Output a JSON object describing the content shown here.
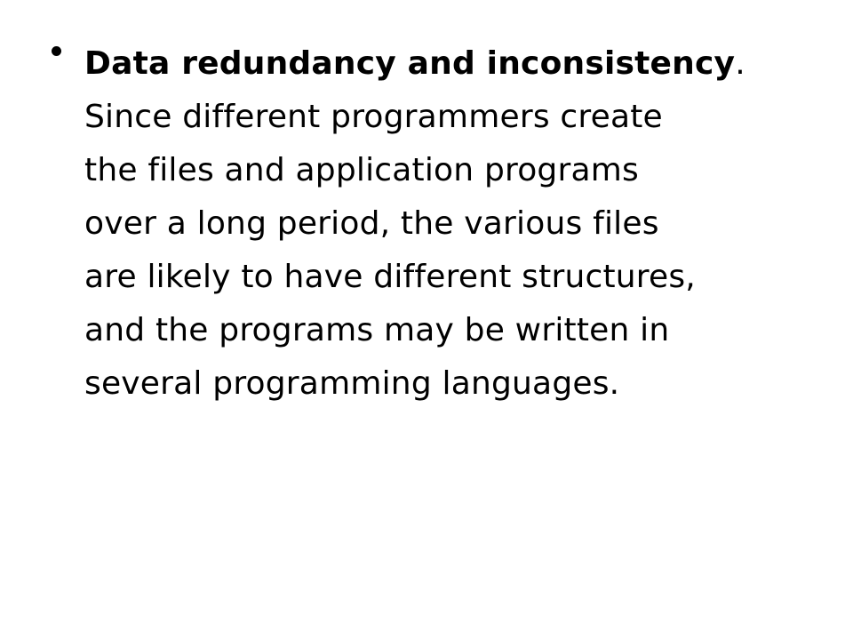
{
  "slide": {
    "bullet": {
      "term": "Data redundancy and inconsistency",
      "term_punct": ".",
      "lines": [
        "Since different programmers create",
        "the files and application programs",
        "over a long period, the various files",
        "are likely to have different structures,",
        "and the programs may be written in",
        "several programming languages."
      ]
    }
  }
}
